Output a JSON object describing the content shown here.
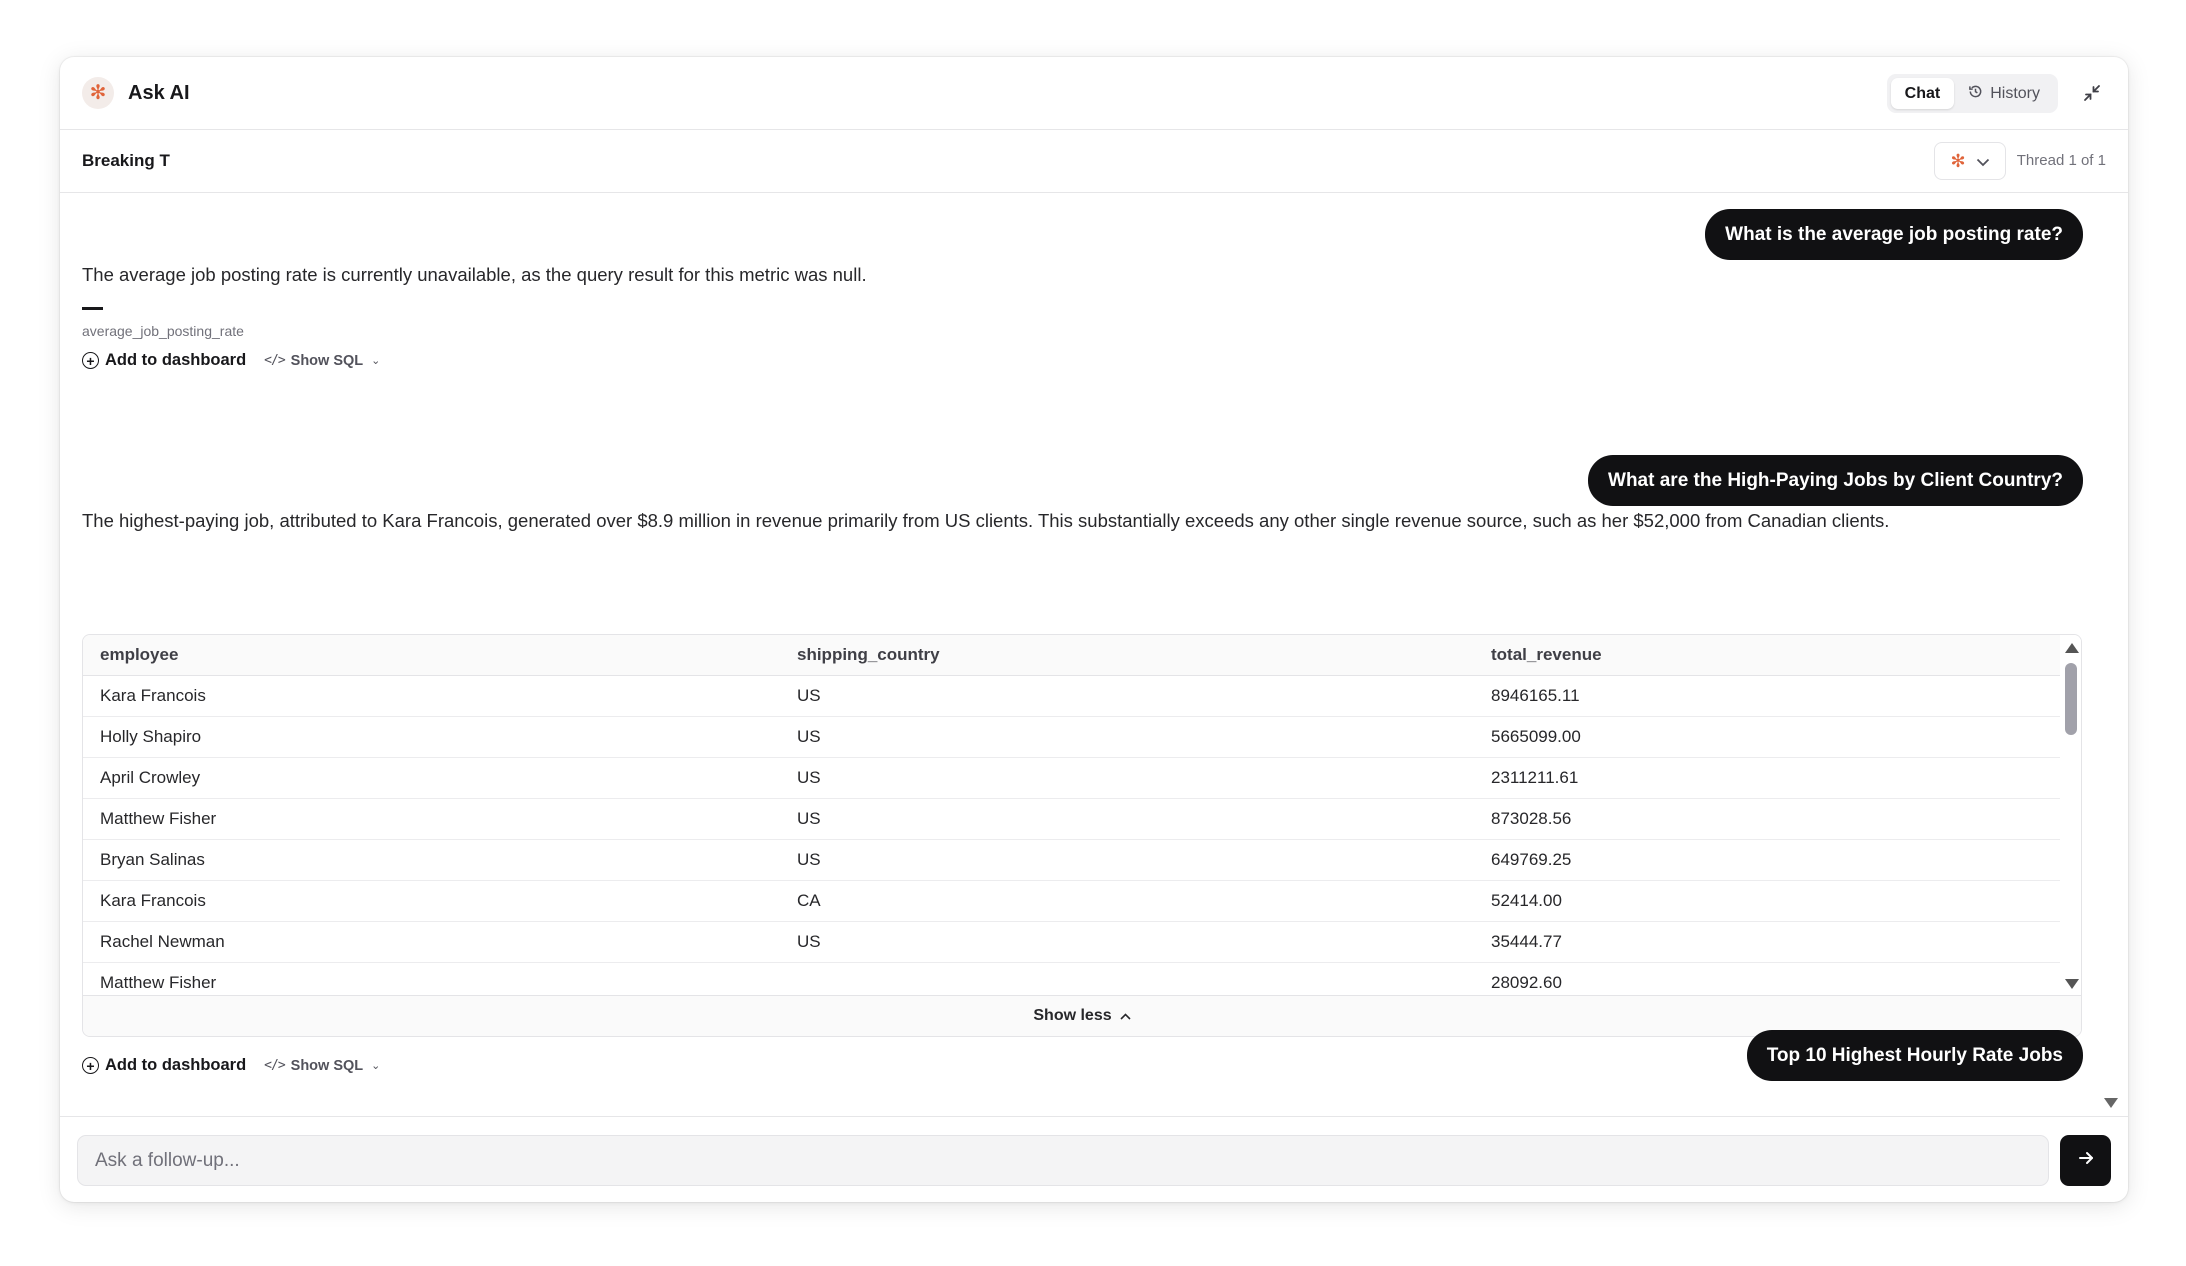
{
  "app": {
    "title": "Ask AI",
    "logo_icon": "sparkle-icon",
    "accent_color": "#e0643a"
  },
  "header": {
    "tabs": [
      {
        "label": "Chat",
        "active": true
      },
      {
        "label": "History",
        "active": false,
        "icon": "history-icon"
      }
    ],
    "collapse_icon": "minimize-icon"
  },
  "thread": {
    "name": "Breaking T",
    "counter": "Thread 1 of 1"
  },
  "messages": {
    "q1": "What is the average job posting rate?",
    "a1": "The average job posting rate is currently unavailable, as the query result for this metric was null.",
    "a1_metric_label": "average_job_posting_rate",
    "q2": "What are the High-Paying Jobs by Client Country?",
    "a2": "The highest-paying job, attributed to Kara Francois, generated over $8.9 million in revenue primarily from US clients. This substantially exceeds any other single revenue source, such as her $52,000 from Canadian clients.",
    "q3": "Top 10 Highest Hourly Rate Jobs"
  },
  "actions": {
    "add_to_dashboard": "Add to dashboard",
    "show_sql": "Show SQL",
    "show_less": "Show less"
  },
  "table": {
    "columns": [
      "employee",
      "shipping_country",
      "total_revenue"
    ],
    "rows": [
      [
        "Kara Francois",
        "US",
        "8946165.11"
      ],
      [
        "Holly Shapiro",
        "US",
        "5665099.00"
      ],
      [
        "April Crowley",
        "US",
        "2311211.61"
      ],
      [
        "Matthew Fisher",
        "US",
        "873028.56"
      ],
      [
        "Bryan Salinas",
        "US",
        "649769.25"
      ],
      [
        "Kara Francois",
        "CA",
        "52414.00"
      ],
      [
        "Rachel Newman",
        "US",
        "35444.77"
      ],
      [
        "Matthew Fisher",
        "",
        "28092.60"
      ]
    ]
  },
  "composer": {
    "placeholder": "Ask a follow-up...",
    "send_icon": "arrow-right-icon"
  }
}
